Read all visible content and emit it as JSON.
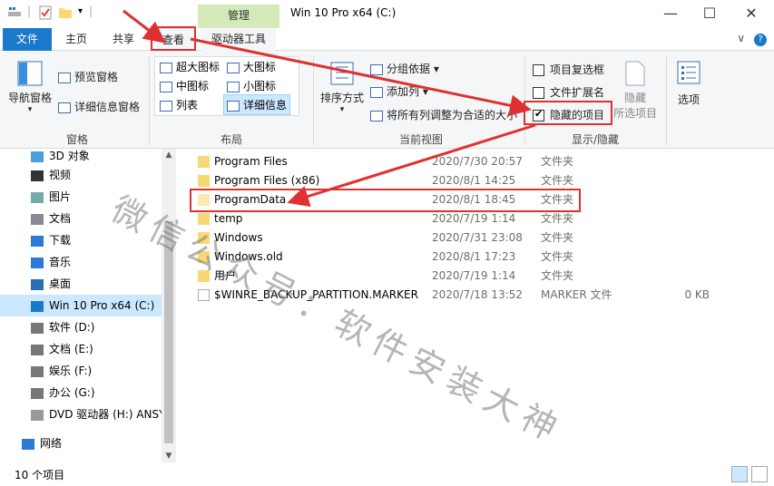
{
  "window": {
    "title": "Win 10 Pro x64 (C:)",
    "context_tab": "管理",
    "controls": {
      "minimize": "—",
      "maximize": "☐",
      "close": "✕"
    }
  },
  "tabs": {
    "file": "文件",
    "home": "主页",
    "share": "共享",
    "view": "查看",
    "drive_tools": "驱动器工具",
    "expand": "∨",
    "help": "?"
  },
  "ribbon": {
    "panes": {
      "group": "窗格",
      "nav_pane": "导航窗格",
      "preview_pane": "预览窗格",
      "details_pane": "详细信息窗格"
    },
    "layout": {
      "group": "布局",
      "extra_large": "超大图标",
      "large": "大图标",
      "medium": "中图标",
      "small": "小图标",
      "list": "列表",
      "details": "详细信息"
    },
    "current_view": {
      "group": "当前视图",
      "sort_by": "排序方式",
      "group_by": "分组依据",
      "add_columns": "添加列",
      "size_all_columns": "将所有列调整为合适的大小"
    },
    "show_hide": {
      "group": "显示/隐藏",
      "item_checkboxes": "项目复选框",
      "item_checkboxes_checked": false,
      "file_extensions": "文件扩展名",
      "file_extensions_checked": false,
      "hidden_items": "隐藏的项目",
      "hidden_items_checked": true,
      "hide_selected": "隐藏",
      "hide_selected_2": "所选项目"
    },
    "options": "选项"
  },
  "nav_pane": {
    "items": [
      {
        "label": "3D 对象",
        "icon": "3d-objects-icon"
      },
      {
        "label": "视频",
        "icon": "video-icon"
      },
      {
        "label": "图片",
        "icon": "pictures-icon"
      },
      {
        "label": "文档",
        "icon": "documents-icon"
      },
      {
        "label": "下载",
        "icon": "download-icon"
      },
      {
        "label": "音乐",
        "icon": "music-icon"
      },
      {
        "label": "桌面",
        "icon": "desktop-icon"
      },
      {
        "label": "Win 10 Pro x64 (C:)",
        "icon": "system-drive-icon",
        "selected": true
      },
      {
        "label": "软件 (D:)",
        "icon": "drive-icon"
      },
      {
        "label": "文档 (E:)",
        "icon": "drive-icon"
      },
      {
        "label": "娱乐 (F:)",
        "icon": "drive-icon"
      },
      {
        "label": "办公 (G:)",
        "icon": "drive-icon"
      },
      {
        "label": "DVD 驱动器 (H:) ANSY",
        "icon": "dvd-icon"
      },
      {
        "label": "网络",
        "icon": "network-icon"
      }
    ]
  },
  "files": [
    {
      "name": "Program Files",
      "date": "2020/7/30 20:57",
      "type": "文件夹",
      "size": "",
      "kind": "folder"
    },
    {
      "name": "Program Files (x86)",
      "date": "2020/8/1 14:25",
      "type": "文件夹",
      "size": "",
      "kind": "folder"
    },
    {
      "name": "ProgramData",
      "date": "2020/8/1 18:45",
      "type": "文件夹",
      "size": "",
      "kind": "folder-hidden"
    },
    {
      "name": "temp",
      "date": "2020/7/19 1:14",
      "type": "文件夹",
      "size": "",
      "kind": "folder"
    },
    {
      "name": "Windows",
      "date": "2020/7/31 23:08",
      "type": "文件夹",
      "size": "",
      "kind": "folder"
    },
    {
      "name": "Windows.old",
      "date": "2020/8/1 17:23",
      "type": "文件夹",
      "size": "",
      "kind": "folder"
    },
    {
      "name": "用户",
      "date": "2020/7/19 1:14",
      "type": "文件夹",
      "size": "",
      "kind": "folder"
    },
    {
      "name": "$WINRE_BACKUP_PARTITION.MARKER",
      "date": "2020/7/18 13:52",
      "type": "MARKER 文件",
      "size": "0 KB",
      "kind": "file"
    }
  ],
  "status": {
    "item_count": "10 个项目"
  },
  "watermark": "微信公众号：软件安装大神",
  "colors": {
    "accent": "#1979ca",
    "context_tab": "#d4eab8",
    "selection": "#cce8ff",
    "annotation": "#e03030",
    "folder": "#f8d775"
  }
}
